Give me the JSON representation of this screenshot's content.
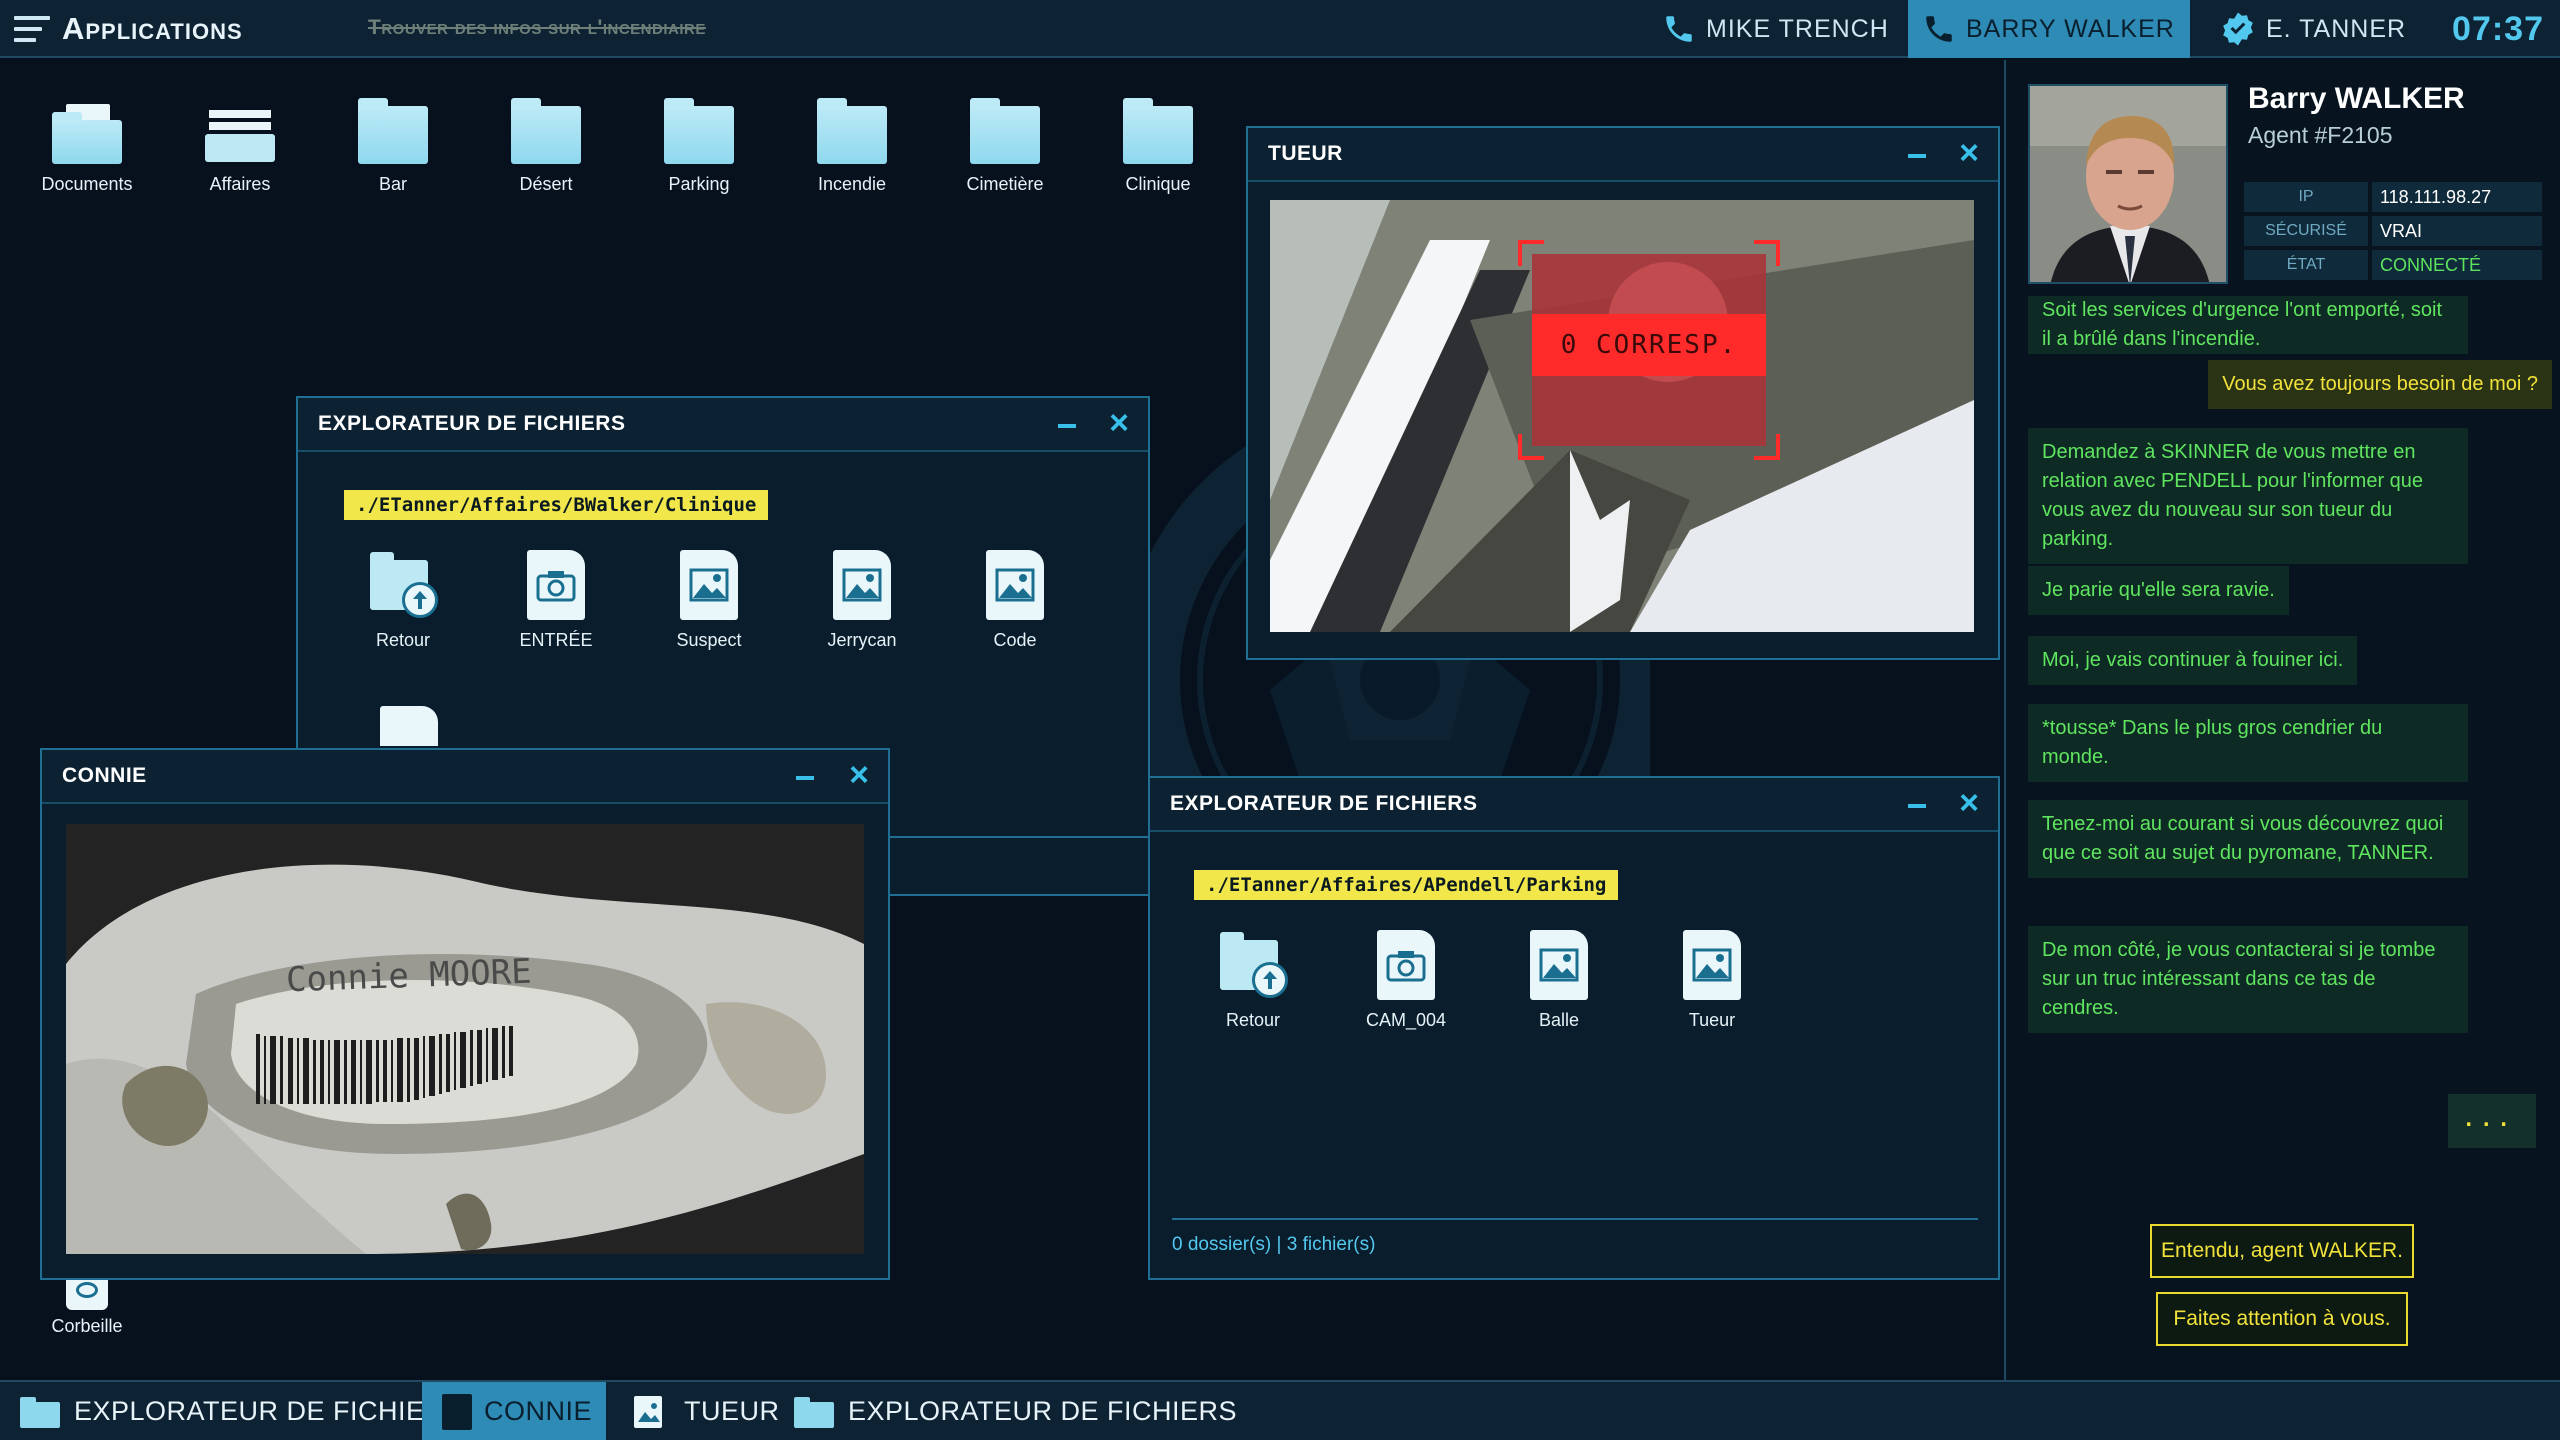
{
  "topbar": {
    "app_menu_label": "Applications",
    "objective": "Trouver des infos sur l'incendiaire",
    "contacts": [
      {
        "name": "MIKE TRENCH",
        "active": false
      },
      {
        "name": "BARRY WALKER",
        "active": true
      },
      {
        "name": "E. TANNER",
        "active": false
      }
    ],
    "clock": "07:37"
  },
  "desktop": {
    "icons": [
      {
        "label": "Documents",
        "icon": "documents-folder-icon"
      },
      {
        "label": "Affaires",
        "icon": "cases-tray-icon"
      },
      {
        "label": "Bar",
        "icon": "folder-icon"
      },
      {
        "label": "Désert",
        "icon": "folder-icon"
      },
      {
        "label": "Parking",
        "icon": "folder-icon"
      },
      {
        "label": "Incendie",
        "icon": "folder-icon"
      },
      {
        "label": "Cimetière",
        "icon": "folder-icon"
      },
      {
        "label": "Clinique",
        "icon": "folder-icon"
      }
    ],
    "trash_label": "Corbeille"
  },
  "windows": {
    "explorer1": {
      "title": "EXPLORATEUR DE FICHIERS",
      "path": "./ETanner/Affaires/BWalker/Clinique",
      "files": [
        {
          "label": "Retour",
          "type": "back"
        },
        {
          "label": "ENTRÉE",
          "type": "photo"
        },
        {
          "label": "Suspect",
          "type": "image"
        },
        {
          "label": "Jerrycan",
          "type": "image"
        },
        {
          "label": "Code",
          "type": "image"
        }
      ]
    },
    "tueur": {
      "title": "TUEUR",
      "match_label": "0 CORRESP."
    },
    "connie": {
      "title": "CONNIE",
      "tag_text": "Connie MOORE"
    },
    "explorer2": {
      "title": "EXPLORATEUR DE FICHIERS",
      "path": "./ETanner/Affaires/APendell/Parking",
      "files": [
        {
          "label": "Retour",
          "type": "back"
        },
        {
          "label": "CAM_004",
          "type": "photo"
        },
        {
          "label": "Balle",
          "type": "image"
        },
        {
          "label": "Tueur",
          "type": "image"
        }
      ],
      "status": "0 dossier(s) | 3 fichier(s)"
    }
  },
  "chat": {
    "agent_name": "Barry WALKER",
    "agent_id": "Agent #F2105",
    "info": [
      {
        "key": "IP",
        "value": "118.111.98.27"
      },
      {
        "key": "SÉCURISÉ",
        "value": "VRAI"
      },
      {
        "key": "ÉTAT",
        "value": "CONNECTÉ"
      }
    ],
    "messages": [
      {
        "from": "agent",
        "text": "Soit les services d'urgence l'ont emporté, soit il a brûlé dans l'incendie."
      },
      {
        "from": "player",
        "text": "Vous avez toujours besoin de moi ?"
      },
      {
        "from": "agent",
        "text": "Demandez à SKINNER de vous mettre en relation avec PENDELL pour l'informer que vous avez du nouveau sur son tueur du parking."
      },
      {
        "from": "agent",
        "text": "Je parie qu'elle sera ravie."
      },
      {
        "from": "agent",
        "text": "Moi, je vais continuer à fouiner ici."
      },
      {
        "from": "agent",
        "text": "*tousse* Dans le plus gros cendrier du monde."
      },
      {
        "from": "agent",
        "text": "Tenez-moi au courant si vous découvrez quoi que ce soit au sujet du pyromane, TANNER."
      },
      {
        "from": "agent",
        "text": "De mon côté, je vous contacterai si je tombe sur un truc intéressant dans ce tas de cendres."
      }
    ],
    "more": "...",
    "replies": [
      "Entendu, agent WALKER.",
      "Faites attention à vous."
    ]
  },
  "taskbar": {
    "items": [
      {
        "label": "EXPLORATEUR DE FICHIERS",
        "active": false
      },
      {
        "label": "CONNIE",
        "active": true
      },
      {
        "label": "TUEUR",
        "active": false
      },
      {
        "label": "EXPLORATEUR DE FICHIERS",
        "active": false
      }
    ]
  },
  "colors": {
    "accent": "#38c0ea",
    "active_tab": "#2e8bb5",
    "path_highlight": "#f1e74b",
    "agent_text": "#5fe55f",
    "player_text": "#f1e23b",
    "alert": "#ff2a2a"
  }
}
